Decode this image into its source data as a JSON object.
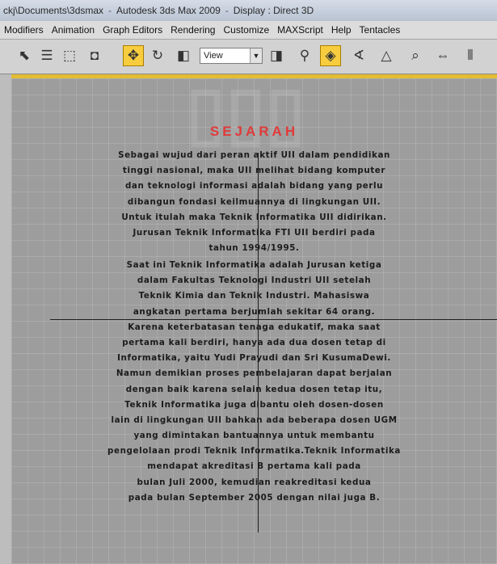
{
  "window": {
    "path": "ckj\\Documents\\3dsmax",
    "app": "Autodesk 3ds Max  2009",
    "display": "Display : Direct 3D"
  },
  "menu": [
    "Modifiers",
    "Animation",
    "Graph Editors",
    "Rendering",
    "Customize",
    "MAXScript",
    "Help",
    "Tentacles"
  ],
  "toolbar": {
    "view_select": "View",
    "icons": [
      "select-object-icon",
      "select-by-name-icon",
      "rect-selection-icon",
      "window-crossing-icon",
      "move-icon",
      "rotate-icon",
      "scale-icon",
      "reference-coordinate-icon",
      "pivot-icon",
      "snap-icon",
      "angle-snap-icon",
      "percent-snap-icon",
      "spinner-snap-icon",
      "named-selection-icon",
      "mirror-icon",
      "align-icon"
    ]
  },
  "viewport": {
    "heading": "SEJARAH",
    "paragraph1": [
      "Sebagai wujud dari peran aktif UII dalam pendidikan",
      "tinggi nasional, maka UII melihat bidang komputer",
      "dan teknologi informasi adalah bidang yang perlu",
      "dibangun fondasi keilmuannya di lingkungan UII.",
      "Untuk itulah maka Teknik Informatika UII didirikan.",
      "Jurusan Teknik Informatika FTI UII berdiri pada",
      "tahun 1994/1995."
    ],
    "paragraph2": [
      "Saat ini Teknik Informatika adalah Jurusan ketiga",
      "dalam Fakultas Teknologi Industri UII setelah",
      "Teknik Kimia dan Teknik Industri. Mahasiswa",
      "angkatan pertama berjumlah sekitar 64 orang.",
      "Karena keterbatasan tenaga edukatif, maka saat",
      "pertama kali berdiri, hanya ada dua dosen tetap di",
      "Informatika, yaitu Yudi Prayudi dan Sri KusumaDewi.",
      "Namun demikian proses pembelajaran dapat berjalan",
      "dengan baik karena selain kedua dosen tetap itu,",
      "Teknik Informatika juga dibantu oleh dosen-dosen",
      "lain di lingkungan UII bahkan ada beberapa dosen UGM",
      "yang dimintakan bantuannya untuk membantu",
      "pengelolaan prodi Teknik Informatika.Teknik Informatika",
      "mendapat akreditasi B pertama kali pada",
      "bulan Juli 2000, kemudian reakreditasi kedua",
      "pada bulan September 2005 dengan nilai juga B."
    ]
  }
}
